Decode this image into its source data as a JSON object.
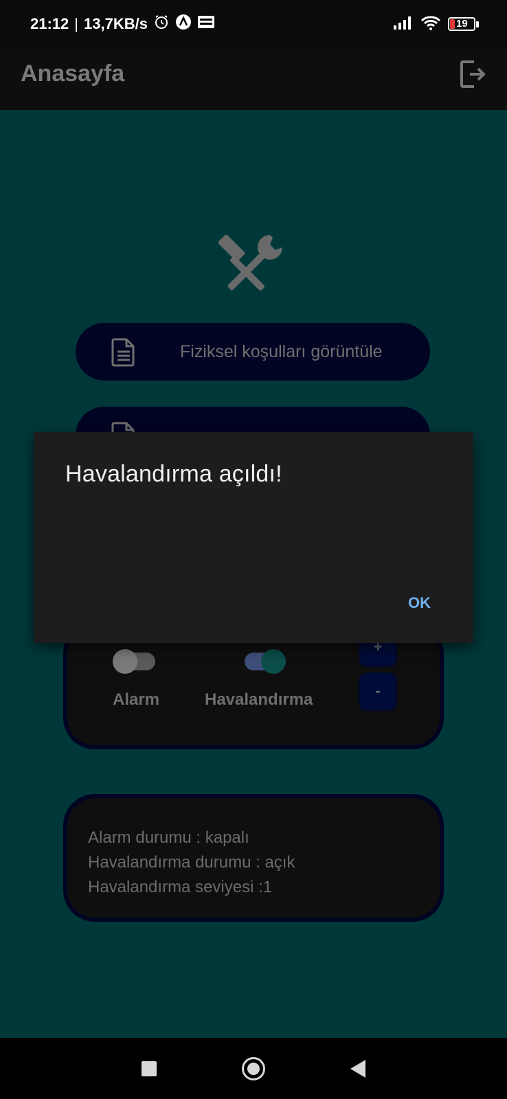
{
  "status_bar": {
    "time": "21:12",
    "speed": "13,7KB/s",
    "battery": "19",
    "icons": [
      "alarm-icon",
      "app-a-icon",
      "webtoon-icon",
      "signal-icon",
      "wifi-icon",
      "battery-icon"
    ]
  },
  "app_bar": {
    "title": "Anasayfa",
    "logout_icon": "logout-icon"
  },
  "main": {
    "header_icon": "tools-icon",
    "buttons": [
      {
        "label": "Fiziksel koşulları görüntüle",
        "icon": "document-icon"
      },
      {
        "label": "",
        "icon": "document-icon"
      }
    ],
    "controls": {
      "alarm_label": "Alarm",
      "alarm_on": false,
      "ventilation_label": "Havalandırma",
      "ventilation_on": true,
      "plus_label": "+",
      "minus_label": "-"
    },
    "status": {
      "alarm": "Alarm durumu : kapalı",
      "ventilation": "Havalandırma durumu : açık",
      "level": "Havalandırma seviyesi :1"
    }
  },
  "dialog": {
    "title": "Havalandırma açıldı!",
    "ok_label": "OK"
  },
  "nav_bar": {
    "icons": [
      "recents-icon",
      "home-icon",
      "back-icon"
    ]
  },
  "colors": {
    "background": "#00383a",
    "pill": "#020423",
    "card": "#0f0f0f",
    "dialog": "#1d1d1d",
    "accent": "#6fb0ee"
  }
}
